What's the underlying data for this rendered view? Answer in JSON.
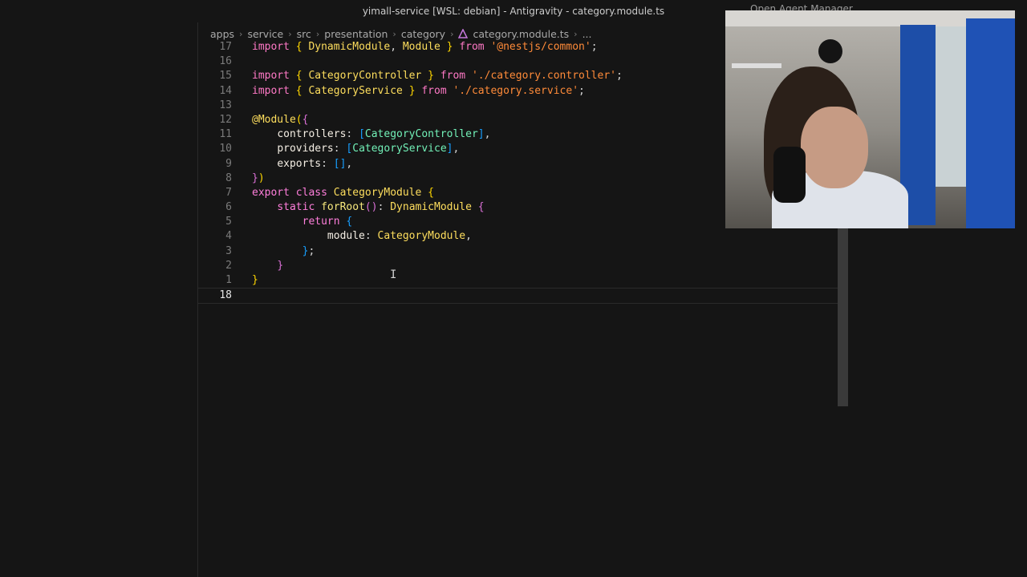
{
  "window": {
    "title": "yimall-service [WSL: debian] - Antigravity - category.module.ts"
  },
  "breadcrumb": {
    "items": [
      "apps",
      "service",
      "src",
      "presentation",
      "category",
      "category.module.ts",
      "..."
    ]
  },
  "editor": {
    "lines": [
      {
        "n": "17",
        "current": false
      },
      {
        "n": "16",
        "current": false
      },
      {
        "n": "15",
        "current": false
      },
      {
        "n": "14",
        "current": false
      },
      {
        "n": "13",
        "current": false
      },
      {
        "n": "12",
        "current": false
      },
      {
        "n": "11",
        "current": false
      },
      {
        "n": "10",
        "current": false
      },
      {
        "n": "9",
        "current": false
      },
      {
        "n": "8",
        "current": false
      },
      {
        "n": "7",
        "current": false
      },
      {
        "n": "6",
        "current": false
      },
      {
        "n": "5",
        "current": false
      },
      {
        "n": "4",
        "current": false
      },
      {
        "n": "3",
        "current": false
      },
      {
        "n": "2",
        "current": false
      },
      {
        "n": "1",
        "current": false
      },
      {
        "n": "18",
        "current": true
      }
    ],
    "tokens": {
      "import": "import",
      "lb": "{",
      "rb": "}",
      "DynamicModule": "DynamicModule",
      "comma": ",",
      "Module": "Module",
      "from": "from",
      "semi": ";",
      "s_common": "'@nestjs/common'",
      "CategoryController": "CategoryController",
      "s_controller": "'./category.controller'",
      "CategoryService": "CategoryService",
      "s_service": "'./category.service'",
      "atModule": "@Module",
      "lp": "(",
      "rp": ")",
      "controllers": "controllers",
      "colon": ":",
      "lsb": "[",
      "rsb": "]",
      "providers": "providers",
      "exports": "exports",
      "export": "export",
      "class": "class",
      "CategoryModule": "CategoryModule",
      "static": "static",
      "forRoot": "forRoot",
      "return": "return",
      "module": "module"
    }
  },
  "topright": {
    "text": "Open Agent Manager"
  },
  "colors": {
    "background": "#151515",
    "keyword": "#ff7edb",
    "class": "#fede5d",
    "string": "#ff8b39",
    "type": "#72f1b8"
  },
  "icons": [
    "file-ts-icon",
    "chevron-right-icon",
    "text-cursor-icon"
  ]
}
